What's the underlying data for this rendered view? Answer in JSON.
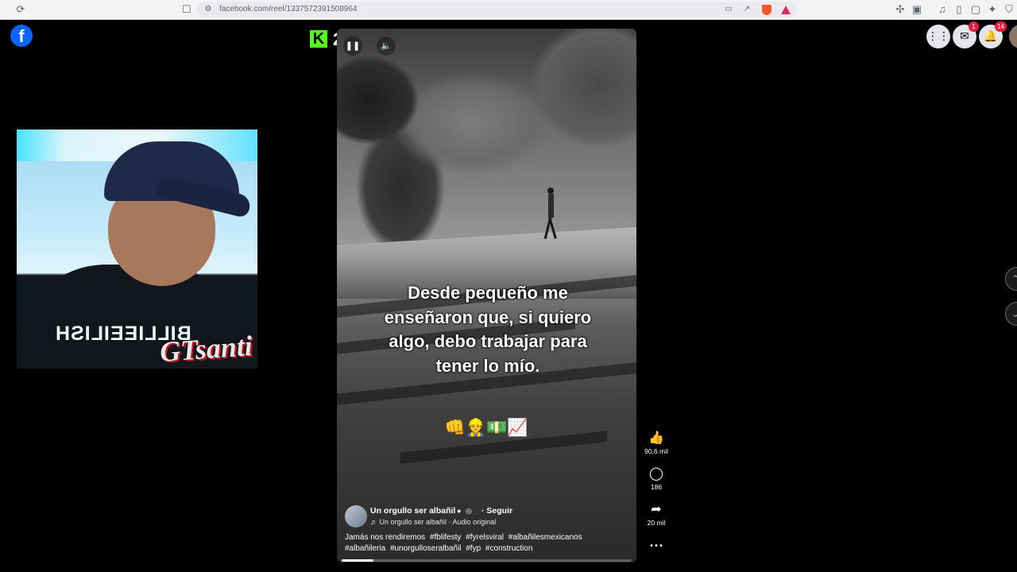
{
  "browser": {
    "url": "facebook.com/reel/1337572391508964",
    "icons": [
      "reload-icon",
      "bookmark-icon",
      "site-info-icon",
      "cast-icon",
      "share-icon",
      "brave-shield-icon",
      "brave-rewards-icon",
      "extensions-icon",
      "media-icon",
      "sidebar-icon",
      "wallet-icon",
      "leo-icon",
      "vpn-icon"
    ]
  },
  "facebook": {
    "logo": "f",
    "notifications": {
      "messenger_badge": "1",
      "notifications_badge": "14"
    }
  },
  "stream_overlay": {
    "kick_logo": "K",
    "viewer_count": "2",
    "shirt_text": "BILLIEEILISH",
    "watermark": "GTsanti"
  },
  "reel": {
    "caption": "Desde pequeño me enseñaron que, si quiero algo, debo trabajar para tener lo mío.",
    "emojis": "👊👷💵📈",
    "author": "Un orgullo ser albañil",
    "follow_label": "· Seguir",
    "audio": "♬ Un orgullo ser albañil · Audio original",
    "description": "Jamás nos rendiremos",
    "hashtags": [
      "#fblifesty",
      "#fyrelsviral",
      "#albañilesmexicanos",
      "#albañileria",
      "#unorgulloseralbañil",
      "#fyp",
      "#construction"
    ],
    "progress": 0.11,
    "likes": "90,6 mil",
    "comments": "186",
    "shares": "20 mil",
    "more": "•••"
  }
}
